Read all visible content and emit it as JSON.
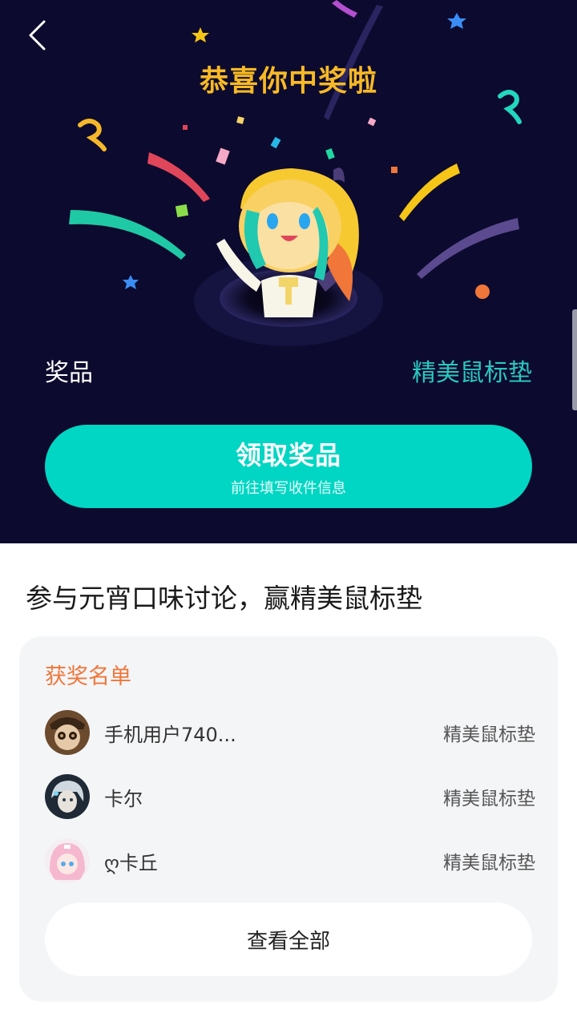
{
  "header": {
    "title": "恭喜你中奖啦"
  },
  "prize": {
    "label": "奖品",
    "value": "精美鼠标垫"
  },
  "claim": {
    "title": "领取奖品",
    "subtitle": "前往填写收件信息"
  },
  "section": {
    "title": "参与元宵口味讨论，赢精美鼠标垫"
  },
  "winners": {
    "title": "获奖名单",
    "items": [
      {
        "name": "手机用户740...",
        "prize": "精美鼠标垫"
      },
      {
        "name": "卡尔",
        "prize": "精美鼠标垫"
      },
      {
        "name": "ღ卡丘",
        "prize": "精美鼠标垫"
      }
    ],
    "view_all": "查看全部"
  },
  "icons": {
    "back": "chevron-left-icon"
  },
  "colors": {
    "background_dark": "#0c0a2e",
    "title_gold": "#f7b925",
    "teal_accent": "#00d6c3",
    "prize_teal": "#2ac7c0",
    "orange_title": "#f0763a",
    "card_gray": "#f4f5f7"
  }
}
